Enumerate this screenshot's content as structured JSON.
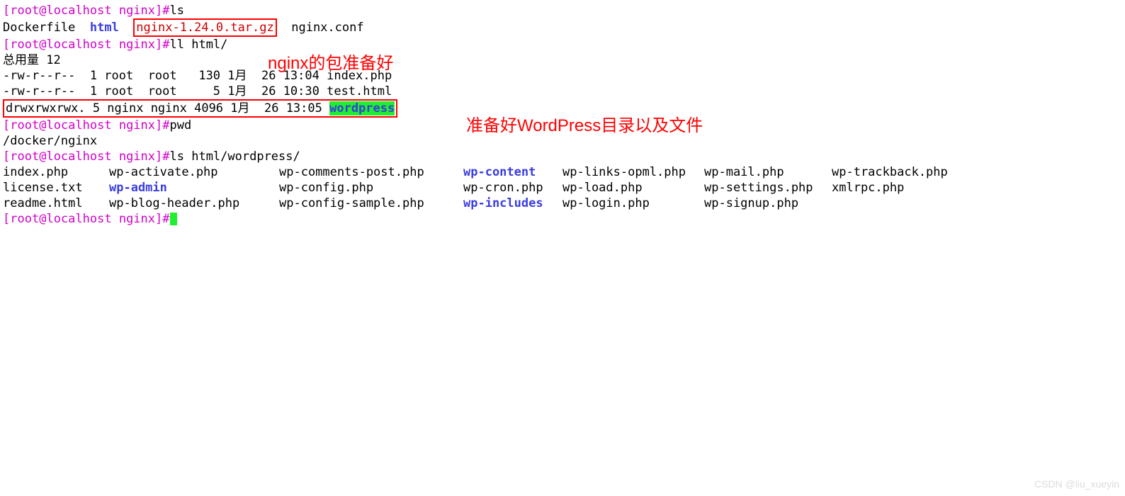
{
  "prompt": {
    "user": "root",
    "host": "localhost",
    "dir": "nginx",
    "hash": "#"
  },
  "cmd1": "ls",
  "ls_out": {
    "a": "Dockerfile",
    "b": "html",
    "c": "nginx-1.24.0.tar.gz",
    "d": "nginx.conf"
  },
  "cmd2": "ll html/",
  "ll": {
    "total": "总用量 12",
    "r0": "-rw-r--r--  1 root  root   130 1月  26 13:04 index.php",
    "r1": "-rw-r--r--  1 root  root     5 1月  26 10:30 test.html",
    "r2_perm": "drwxrwxrwx. 5 nginx nginx 4096 1月  26 13:05 ",
    "r2_name": "wordpress"
  },
  "cmd3": "pwd",
  "pwd_out": "/docker/nginx",
  "cmd4": "ls html/wordpress/",
  "wp": {
    "r0": {
      "c0": "index.php",
      "c1": "wp-activate.php",
      "c2": "wp-comments-post.php",
      "c3": "wp-content",
      "c4": "wp-links-opml.php",
      "c5": "wp-mail.php",
      "c6": "wp-trackback.php"
    },
    "r1": {
      "c0": "license.txt",
      "c1": "wp-admin",
      "c2": "wp-config.php",
      "c3": "wp-cron.php",
      "c4": "wp-load.php",
      "c5": "wp-settings.php",
      "c6": "xmlrpc.php"
    },
    "r2": {
      "c0": "readme.html",
      "c1": "wp-blog-header.php",
      "c2": "wp-config-sample.php",
      "c3": "wp-includes",
      "c4": "wp-login.php",
      "c5": "wp-signup.php",
      "c6": ""
    }
  },
  "annot1": "nginx的包准备好",
  "annot2": "准备好WordPress目录以及文件",
  "watermark": "CSDN @liu_xueyin"
}
